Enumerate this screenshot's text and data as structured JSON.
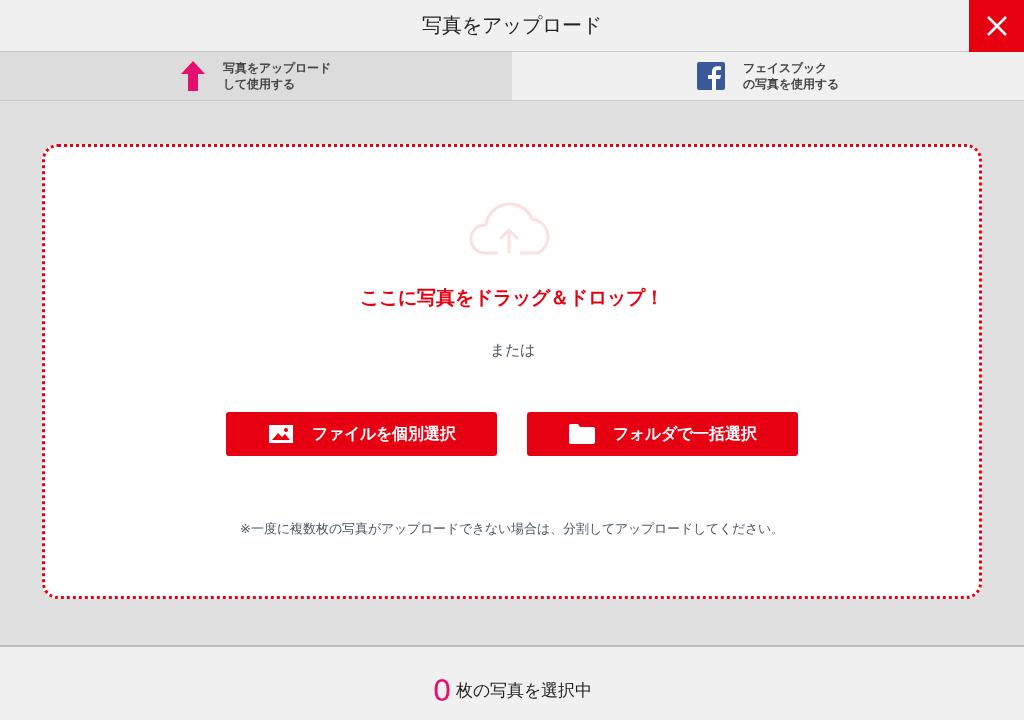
{
  "window": {
    "title": "写真をアップロード"
  },
  "tabs": [
    {
      "kind": "upload",
      "label_lines": [
        "写真をアップロード",
        "して使用する"
      ],
      "selected": true
    },
    {
      "kind": "facebook",
      "label_lines": [
        "フェイスブック",
        "の写真を使用する"
      ],
      "selected": false
    }
  ],
  "dropzone": {
    "heading": "ここに写真をドラッグ＆ドロップ！",
    "or": "または",
    "buttons": [
      {
        "kind": "image",
        "label": "ファイルを個別選択"
      },
      {
        "kind": "folder",
        "label": "フォルダで一括選択"
      }
    ],
    "note": "※一度に複数枚の写真がアップロードできない場合は、分割してアップロードしてください。"
  },
  "footer": {
    "count": "0",
    "label": "枚の写真を選択中"
  }
}
